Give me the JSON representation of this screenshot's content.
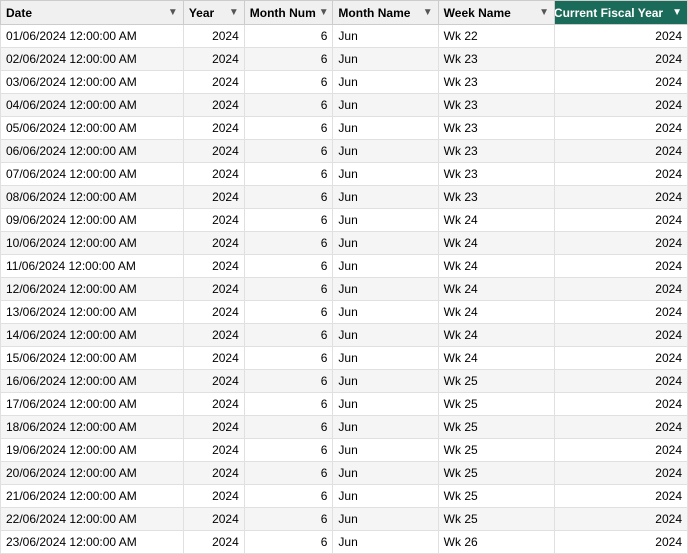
{
  "table": {
    "columns": [
      {
        "id": "date",
        "label": "Date",
        "class": "col-date"
      },
      {
        "id": "year",
        "label": "Year",
        "class": "col-year"
      },
      {
        "id": "monthnum",
        "label": "Month Num",
        "class": "col-monthnum"
      },
      {
        "id": "monthname",
        "label": "Month Name",
        "class": "col-monthname"
      },
      {
        "id": "weekname",
        "label": "Week Name",
        "class": "col-weekname"
      },
      {
        "id": "fiscal",
        "label": "Current Fiscal Year",
        "class": "col-fiscal"
      }
    ],
    "rows": [
      {
        "date": "01/06/2024 12:00:00 AM",
        "year": "2024",
        "monthnum": "6",
        "monthname": "Jun",
        "weekname": "Wk 22",
        "fiscal": "2024"
      },
      {
        "date": "02/06/2024 12:00:00 AM",
        "year": "2024",
        "monthnum": "6",
        "monthname": "Jun",
        "weekname": "Wk 23",
        "fiscal": "2024"
      },
      {
        "date": "03/06/2024 12:00:00 AM",
        "year": "2024",
        "monthnum": "6",
        "monthname": "Jun",
        "weekname": "Wk 23",
        "fiscal": "2024"
      },
      {
        "date": "04/06/2024 12:00:00 AM",
        "year": "2024",
        "monthnum": "6",
        "monthname": "Jun",
        "weekname": "Wk 23",
        "fiscal": "2024"
      },
      {
        "date": "05/06/2024 12:00:00 AM",
        "year": "2024",
        "monthnum": "6",
        "monthname": "Jun",
        "weekname": "Wk 23",
        "fiscal": "2024"
      },
      {
        "date": "06/06/2024 12:00:00 AM",
        "year": "2024",
        "monthnum": "6",
        "monthname": "Jun",
        "weekname": "Wk 23",
        "fiscal": "2024"
      },
      {
        "date": "07/06/2024 12:00:00 AM",
        "year": "2024",
        "monthnum": "6",
        "monthname": "Jun",
        "weekname": "Wk 23",
        "fiscal": "2024"
      },
      {
        "date": "08/06/2024 12:00:00 AM",
        "year": "2024",
        "monthnum": "6",
        "monthname": "Jun",
        "weekname": "Wk 23",
        "fiscal": "2024"
      },
      {
        "date": "09/06/2024 12:00:00 AM",
        "year": "2024",
        "monthnum": "6",
        "monthname": "Jun",
        "weekname": "Wk 24",
        "fiscal": "2024"
      },
      {
        "date": "10/06/2024 12:00:00 AM",
        "year": "2024",
        "monthnum": "6",
        "monthname": "Jun",
        "weekname": "Wk 24",
        "fiscal": "2024"
      },
      {
        "date": "11/06/2024 12:00:00 AM",
        "year": "2024",
        "monthnum": "6",
        "monthname": "Jun",
        "weekname": "Wk 24",
        "fiscal": "2024"
      },
      {
        "date": "12/06/2024 12:00:00 AM",
        "year": "2024",
        "monthnum": "6",
        "monthname": "Jun",
        "weekname": "Wk 24",
        "fiscal": "2024"
      },
      {
        "date": "13/06/2024 12:00:00 AM",
        "year": "2024",
        "monthnum": "6",
        "monthname": "Jun",
        "weekname": "Wk 24",
        "fiscal": "2024"
      },
      {
        "date": "14/06/2024 12:00:00 AM",
        "year": "2024",
        "monthnum": "6",
        "monthname": "Jun",
        "weekname": "Wk 24",
        "fiscal": "2024"
      },
      {
        "date": "15/06/2024 12:00:00 AM",
        "year": "2024",
        "monthnum": "6",
        "monthname": "Jun",
        "weekname": "Wk 24",
        "fiscal": "2024"
      },
      {
        "date": "16/06/2024 12:00:00 AM",
        "year": "2024",
        "monthnum": "6",
        "monthname": "Jun",
        "weekname": "Wk 25",
        "fiscal": "2024"
      },
      {
        "date": "17/06/2024 12:00:00 AM",
        "year": "2024",
        "monthnum": "6",
        "monthname": "Jun",
        "weekname": "Wk 25",
        "fiscal": "2024"
      },
      {
        "date": "18/06/2024 12:00:00 AM",
        "year": "2024",
        "monthnum": "6",
        "monthname": "Jun",
        "weekname": "Wk 25",
        "fiscal": "2024"
      },
      {
        "date": "19/06/2024 12:00:00 AM",
        "year": "2024",
        "monthnum": "6",
        "monthname": "Jun",
        "weekname": "Wk 25",
        "fiscal": "2024"
      },
      {
        "date": "20/06/2024 12:00:00 AM",
        "year": "2024",
        "monthnum": "6",
        "monthname": "Jun",
        "weekname": "Wk 25",
        "fiscal": "2024"
      },
      {
        "date": "21/06/2024 12:00:00 AM",
        "year": "2024",
        "monthnum": "6",
        "monthname": "Jun",
        "weekname": "Wk 25",
        "fiscal": "2024"
      },
      {
        "date": "22/06/2024 12:00:00 AM",
        "year": "2024",
        "monthnum": "6",
        "monthname": "Jun",
        "weekname": "Wk 25",
        "fiscal": "2024"
      },
      {
        "date": "23/06/2024 12:00:00 AM",
        "year": "2024",
        "monthnum": "6",
        "monthname": "Jun",
        "weekname": "Wk 26",
        "fiscal": "2024"
      }
    ]
  }
}
